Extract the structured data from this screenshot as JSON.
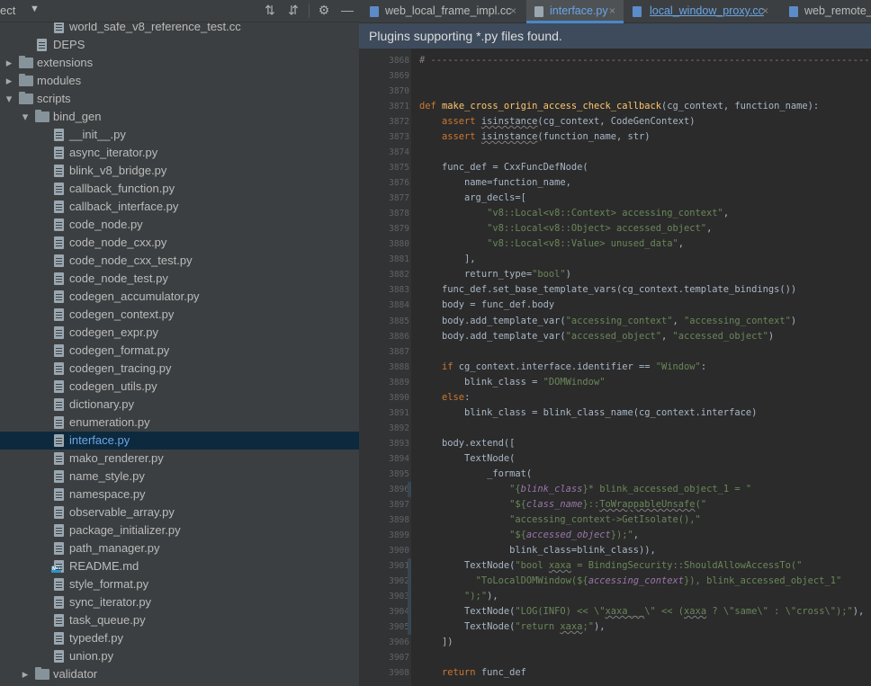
{
  "project_panel": {
    "title": "ect",
    "tree": [
      {
        "label": "world_safe_v8_reference_test.cc",
        "kind": "file",
        "depth": 3
      },
      {
        "label": "DEPS",
        "kind": "file",
        "depth": 2
      },
      {
        "label": "extensions",
        "kind": "folder",
        "depth": 1,
        "expanded": false
      },
      {
        "label": "modules",
        "kind": "folder",
        "depth": 1,
        "expanded": false
      },
      {
        "label": "scripts",
        "kind": "folder",
        "depth": 1,
        "expanded": true
      },
      {
        "label": "bind_gen",
        "kind": "folder",
        "depth": 2,
        "expanded": true
      },
      {
        "label": "__init__.py",
        "kind": "file",
        "depth": 3
      },
      {
        "label": "async_iterator.py",
        "kind": "file",
        "depth": 3
      },
      {
        "label": "blink_v8_bridge.py",
        "kind": "file",
        "depth": 3
      },
      {
        "label": "callback_function.py",
        "kind": "file",
        "depth": 3
      },
      {
        "label": "callback_interface.py",
        "kind": "file",
        "depth": 3
      },
      {
        "label": "code_node.py",
        "kind": "file",
        "depth": 3
      },
      {
        "label": "code_node_cxx.py",
        "kind": "file",
        "depth": 3
      },
      {
        "label": "code_node_cxx_test.py",
        "kind": "file",
        "depth": 3
      },
      {
        "label": "code_node_test.py",
        "kind": "file",
        "depth": 3
      },
      {
        "label": "codegen_accumulator.py",
        "kind": "file",
        "depth": 3
      },
      {
        "label": "codegen_context.py",
        "kind": "file",
        "depth": 3
      },
      {
        "label": "codegen_expr.py",
        "kind": "file",
        "depth": 3
      },
      {
        "label": "codegen_format.py",
        "kind": "file",
        "depth": 3
      },
      {
        "label": "codegen_tracing.py",
        "kind": "file",
        "depth": 3
      },
      {
        "label": "codegen_utils.py",
        "kind": "file",
        "depth": 3
      },
      {
        "label": "dictionary.py",
        "kind": "file",
        "depth": 3
      },
      {
        "label": "enumeration.py",
        "kind": "file",
        "depth": 3
      },
      {
        "label": "interface.py",
        "kind": "file",
        "depth": 3,
        "selected": true
      },
      {
        "label": "mako_renderer.py",
        "kind": "file",
        "depth": 3
      },
      {
        "label": "name_style.py",
        "kind": "file",
        "depth": 3
      },
      {
        "label": "namespace.py",
        "kind": "file",
        "depth": 3
      },
      {
        "label": "observable_array.py",
        "kind": "file",
        "depth": 3
      },
      {
        "label": "package_initializer.py",
        "kind": "file",
        "depth": 3
      },
      {
        "label": "path_manager.py",
        "kind": "file",
        "depth": 3
      },
      {
        "label": "README.md",
        "kind": "md",
        "depth": 3
      },
      {
        "label": "style_format.py",
        "kind": "file",
        "depth": 3
      },
      {
        "label": "sync_iterator.py",
        "kind": "file",
        "depth": 3
      },
      {
        "label": "task_queue.py",
        "kind": "file",
        "depth": 3
      },
      {
        "label": "typedef.py",
        "kind": "file",
        "depth": 3
      },
      {
        "label": "union.py",
        "kind": "file",
        "depth": 3
      },
      {
        "label": "validator",
        "kind": "folder",
        "depth": 2,
        "expanded": false
      }
    ]
  },
  "tabs": [
    {
      "label": "web_local_frame_impl.cc",
      "type": "cc",
      "active": false
    },
    {
      "label": "interface.py",
      "type": "py",
      "active": true
    },
    {
      "label": "local_window_proxy.cc",
      "type": "cc",
      "active": false
    },
    {
      "label": "web_remote_f",
      "type": "cc",
      "active": false
    }
  ],
  "notification": {
    "text": "Plugins supporting *.py files found."
  },
  "code": {
    "first_line": 3868,
    "lines": [
      "# ------------------------------------------------------------------------------",
      "",
      "",
      "def make_cross_origin_access_check_callback(cg_context, function_name):",
      "    assert isinstance(cg_context, CodeGenContext)",
      "    assert isinstance(function_name, str)",
      "",
      "    func_def = CxxFuncDefNode(",
      "        name=function_name,",
      "        arg_decls=[",
      "            \"v8::Local<v8::Context> accessing_context\",",
      "            \"v8::Local<v8::Object> accessed_object\",",
      "            \"v8::Local<v8::Value> unused_data\",",
      "        ],",
      "        return_type=\"bool\")",
      "    func_def.set_base_template_vars(cg_context.template_bindings())",
      "    body = func_def.body",
      "    body.add_template_var(\"accessing_context\", \"accessing_context\")",
      "    body.add_template_var(\"accessed_object\", \"accessed_object\")",
      "",
      "    if cg_context.interface.identifier == \"Window\":",
      "        blink_class = \"DOMWindow\"",
      "    else:",
      "        blink_class = blink_class_name(cg_context.interface)",
      "",
      "    body.extend([",
      "        TextNode(",
      "            _format(",
      "                \"{blink_class}* blink_accessed_object_1 = \"",
      "                \"${class_name}::ToWrappableUnsafe(\"",
      "                \"accessing_context->GetIsolate(),\"",
      "                \"${accessed_object});\",",
      "                blink_class=blink_class)),",
      "        TextNode(\"bool xaxa = BindingSecurity::ShouldAllowAccessTo(\"",
      "          \"ToLocalDOMWindow(${accessing_context}), blink_accessed_object_1\"",
      "        \");\"),",
      "        TextNode(\"LOG(INFO) << \\\"xaxa___\\\" << (xaxa ? \\\"same\\\" : \\\"cross\\\");\"),",
      "        TextNode(\"return xaxa;\"),",
      "    ])",
      "",
      "    return func_def"
    ]
  }
}
